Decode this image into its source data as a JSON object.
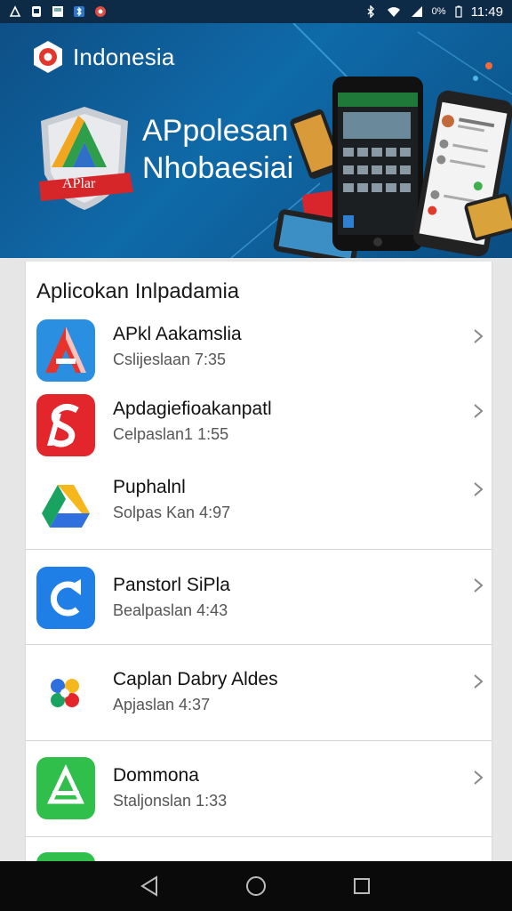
{
  "status_bar": {
    "time": "11:49",
    "battery_text": "0%",
    "icons": [
      "notification-icon",
      "sim-icon",
      "image-icon",
      "bluetooth-icon",
      "app-icon",
      "bluetooth-icon",
      "wifi-icon",
      "signal-icon",
      "battery-icon"
    ]
  },
  "banner": {
    "brand": "Indonesia",
    "shield_label": "APlar",
    "title_line1": "APpolesan",
    "title_line2": "Nhobaesiai"
  },
  "list": {
    "section_title": "Aplicokan Inlpadamia",
    "apps": [
      {
        "name": "APkl Aakamslia",
        "sub": "Cslijeslaan 7:35",
        "icon": "red-a-app-icon"
      },
      {
        "name": "Apdagiefioakanpatl",
        "sub": "Celpaslan1 1:55",
        "icon": "red-s-app-icon"
      },
      {
        "name": "Puphalnl",
        "sub": "Solpas Kan 4:97",
        "icon": "drive-app-icon"
      },
      {
        "name": "Panstorl SiPla",
        "sub": "Bealpaslan 4:43",
        "icon": "blue-c-app-icon"
      },
      {
        "name": "Caplan Dabry Aldes",
        "sub": "Apjaslan 4:37",
        "icon": "colorful-app-icon"
      },
      {
        "name": "Dommona",
        "sub": "Staljonslan 1:33",
        "icon": "green-app-icon"
      }
    ]
  },
  "colors": {
    "banner_bg": "#0f6aa8",
    "statusbar_bg": "#0d2a47",
    "navbar_bg": "#0a0a0a"
  }
}
